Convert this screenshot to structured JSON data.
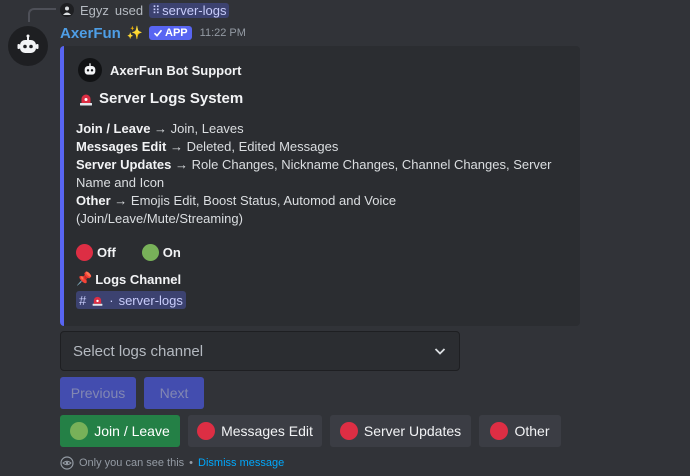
{
  "command": {
    "user": "Egyz",
    "used_text": "used",
    "command_name": "server-logs"
  },
  "message": {
    "author": "AxerFun",
    "app_badge": "APP",
    "timestamp": "11:22 PM"
  },
  "embed": {
    "author": "AxerFun Bot Support",
    "title": "Server Logs System",
    "accent_color": "#5865f2",
    "lines": [
      {
        "label": "Join / Leave",
        "arrow": " → ",
        "text": "Join, Leaves"
      },
      {
        "label": "Messages Edit",
        "arrow": " → ",
        "text": "Deleted, Edited Messages"
      },
      {
        "label": "Server Updates",
        "arrow": " → ",
        "text": "Role Changes, Nickname Changes, Channel Changes, Server Name and Icon"
      },
      {
        "label": "Other",
        "arrow": " → ",
        "text": "Emojis Edit, Boost Status, Automod and Voice (Join/Leave/Mute/Streaming)"
      }
    ],
    "legend_off": "Off",
    "legend_on": "On",
    "logs_channel_title": "Logs Channel",
    "logs_channel_name": "server-logs"
  },
  "select": {
    "placeholder": "Select logs channel"
  },
  "pagination": {
    "previous": "Previous",
    "next": "Next"
  },
  "toggles": [
    {
      "label": "Join / Leave",
      "state": "on"
    },
    {
      "label": "Messages Edit",
      "state": "off"
    },
    {
      "label": "Server Updates",
      "state": "off"
    },
    {
      "label": "Other",
      "state": "off"
    }
  ],
  "ephemeral": {
    "text": "Only you can see this",
    "separator": " • ",
    "dismiss": "Dismiss message"
  }
}
